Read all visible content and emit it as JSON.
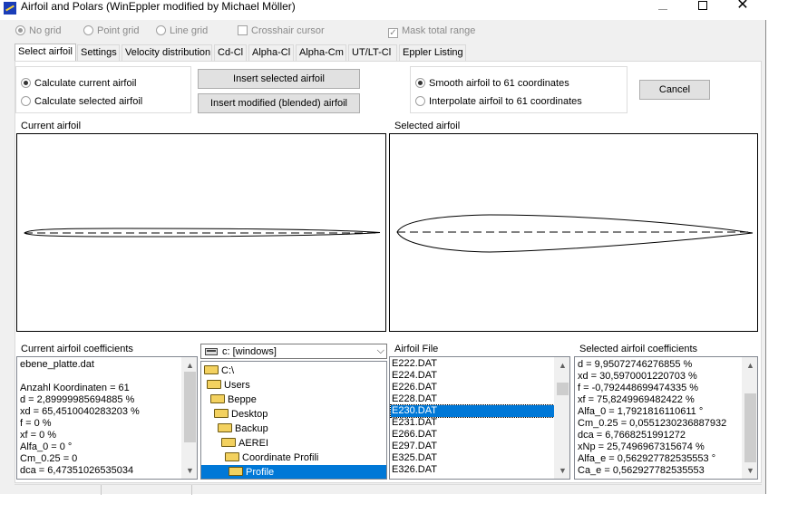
{
  "window": {
    "title": "Airfoil and Polars (WinEppler modified by Michael Möller)",
    "minimize": "—",
    "maximize": "☐",
    "close": "✕"
  },
  "options": {
    "no_grid": "No grid",
    "point_grid": "Point grid",
    "line_grid": "Line grid",
    "crosshair": "Crosshair cursor",
    "mask_total_range": "Mask total range"
  },
  "tabs": [
    "Select airfoil",
    "Settings",
    "Velocity distribution",
    "Cd-Cl",
    "Alpha-Cl",
    "Alpha-Cm",
    "UT/LT-Cl",
    "Eppler Listing"
  ],
  "calc": {
    "current": "Calculate current airfoil",
    "selected": "Calculate selected airfoil"
  },
  "buttons": {
    "insert_selected": "Insert selected airfoil",
    "insert_modified": "Insert modified (blended) airfoil",
    "cancel": "Cancel"
  },
  "smooth": {
    "smooth": "Smooth airfoil to 61 coordinates",
    "interpolate": "Interpolate airfoil to 61 coordinates"
  },
  "labels": {
    "current_airfoil": "Current airfoil",
    "selected_airfoil": "Selected airfoil",
    "current_coeffs": "Current airfoil coefficients",
    "airfoil_file": "Airfoil File",
    "selected_coeffs": "Selected airfoil coefficients"
  },
  "current_coeffs": [
    "ebene_platte.dat",
    "",
    "Anzahl Koordinaten = 61",
    "d = 2,89999985694885 %",
    "xd = 65,4510040283203 %",
    "f = 0 %",
    "xf = 0 %",
    "Alfa_0 = 0 °",
    "Cm_0.25 = 0",
    "dca = 6,47351026535034"
  ],
  "drive": "c: [windows]",
  "dirs": [
    "C:\\",
    "Users",
    "Beppe",
    "Desktop",
    "Backup",
    "AEREI",
    "Coordinate Profili",
    "Profile"
  ],
  "files": [
    "E222.DAT",
    "E224.DAT",
    "E226.DAT",
    "E228.DAT",
    "E230.DAT",
    "E231.DAT",
    "E266.DAT",
    "E297.DAT",
    "E325.DAT",
    "E326.DAT"
  ],
  "selected_file_index": 4,
  "selected_coeffs": [
    "d = 9,95072746276855 %",
    "xd = 30,5970001220703 %",
    "f = -0,792448699474335 %",
    "xf = 75,8249969482422 %",
    "Alfa_0 = 1,7921816110611 °",
    "Cm_0.25 = 0,0551230236887932",
    "dca = 6,7668251991272",
    "xNp = 25,7496967315674 %",
    "Alfa_e = 0,562927782535553 °",
    "Ca_e = 0,562927782535553"
  ]
}
